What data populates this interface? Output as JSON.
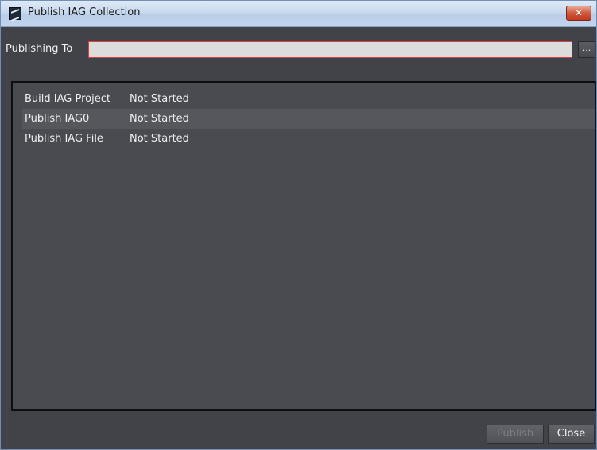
{
  "window": {
    "title": "Publish IAG Collection",
    "close_glyph": "✕",
    "app_icon": "app-icon"
  },
  "publishing": {
    "label": "Publishing To",
    "value": "",
    "browse_label": "..."
  },
  "tasks": [
    {
      "name": "Build IAG Project",
      "status": "Not Started"
    },
    {
      "name": "Publish IAG0",
      "status": "Not Started"
    },
    {
      "name": "Publish IAG File",
      "status": "Not Started"
    }
  ],
  "footer": {
    "publish_label": "Publish",
    "publish_enabled": false,
    "close_label": "Close"
  },
  "colors": {
    "background": "#424349",
    "panel": "#4a4b50",
    "input_error_border": "#d84040"
  }
}
